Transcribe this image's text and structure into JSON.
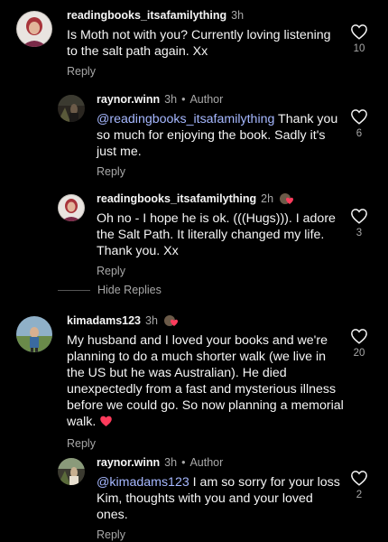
{
  "comments": [
    {
      "username": "readingbooks_itsafamilything",
      "time": "3h",
      "text": "Is Moth not with you? Currently loving listening to the salt path again. Xx",
      "reply": "Reply",
      "likes": "10"
    },
    {
      "username": "raynor.winn",
      "time": "3h",
      "badge": "Author",
      "mention": "@readingbooks_itsafamilything",
      "text": " Thank you so much for enjoying the book. Sadly it's just me.",
      "reply": "Reply",
      "likes": "6"
    },
    {
      "username": "readingbooks_itsafamilything",
      "time": "2h",
      "text": "Oh no - I hope he is ok. (((Hugs))). I adore the Salt Path. It literally changed my life. Thank you. Xx",
      "reply": "Reply",
      "likes": "3"
    },
    {
      "username": "kimadams123",
      "time": "3h",
      "text": "My husband and I loved your books and we're planning to do a much shorter walk (we live in the US but he was Australian). He died unexpectedly from a fast and mysterious illness before we could go. So now planning a memorial walk. ",
      "reply": "Reply",
      "likes": "20"
    },
    {
      "username": "raynor.winn",
      "time": "3h",
      "badge": "Author",
      "mention": "@kimadams123",
      "text": " I am so sorry for your loss Kim, thoughts with you and your loved ones.",
      "reply": "Reply",
      "likes": "2"
    }
  ],
  "hide_replies": "Hide Replies",
  "separator": "•",
  "colors": {
    "background": "#000000",
    "mention": "#a6b8ff",
    "heart_emoji": "#ff3b5c",
    "muted": "#a8a8a8"
  }
}
